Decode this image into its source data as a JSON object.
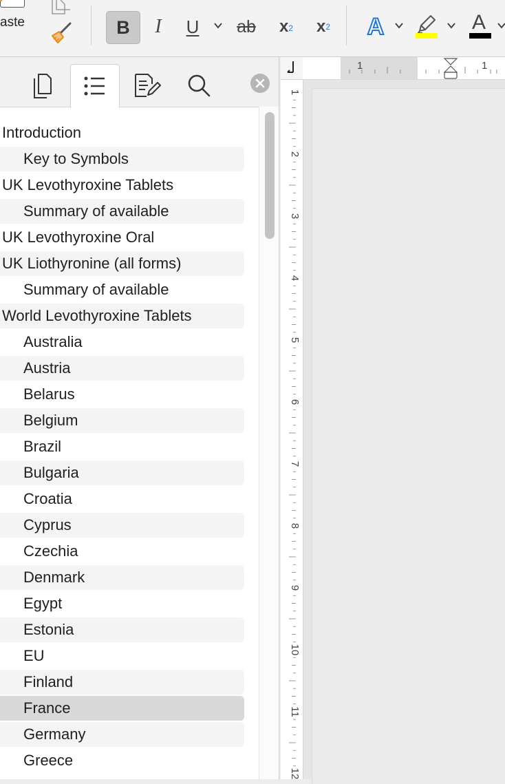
{
  "ribbon": {
    "paste_label": "aste",
    "buttons": {
      "bold": "B",
      "italic": "I",
      "underline": "U",
      "strikethrough": "ab",
      "subscript_base": "x",
      "subscript_mark": "2",
      "superscript_base": "x",
      "superscript_mark": "2",
      "text_effects": "A",
      "font_color": "A"
    },
    "colors": {
      "highlight": "#ffff00",
      "font_color": "#000000",
      "text_effects": "#1f75d9"
    },
    "icons": [
      "copy-icon",
      "format-painter-icon",
      "chevron-down-icon",
      "highlighter-icon"
    ]
  },
  "sidebar": {
    "tabs": [
      {
        "name": "thumbnails",
        "icon": "pages-icon",
        "active": false
      },
      {
        "name": "navigation",
        "icon": "list-icon",
        "active": true
      },
      {
        "name": "comments",
        "icon": "edit-document-icon",
        "active": false
      },
      {
        "name": "search",
        "icon": "search-icon",
        "active": false
      }
    ],
    "close_icon": "close-icon",
    "items": [
      {
        "label": "Introduction",
        "level": 1
      },
      {
        "label": "Key to Symbols",
        "level": 2
      },
      {
        "label": "UK Levothyroxine Tablets",
        "level": 1
      },
      {
        "label": "Summary of available",
        "level": 2
      },
      {
        "label": "UK Levothyroxine Oral",
        "level": 1
      },
      {
        "label": "UK Liothyronine (all forms)",
        "level": 1
      },
      {
        "label": "Summary of available",
        "level": 2
      },
      {
        "label": "World Levothyroxine Tablets",
        "level": 1
      },
      {
        "label": "Australia",
        "level": 2
      },
      {
        "label": "Austria",
        "level": 2
      },
      {
        "label": "Belarus",
        "level": 2
      },
      {
        "label": "Belgium",
        "level": 2
      },
      {
        "label": "Brazil",
        "level": 2
      },
      {
        "label": "Bulgaria",
        "level": 2
      },
      {
        "label": "Croatia",
        "level": 2
      },
      {
        "label": "Cyprus",
        "level": 2
      },
      {
        "label": "Czechia",
        "level": 2
      },
      {
        "label": "Denmark",
        "level": 2
      },
      {
        "label": "Egypt",
        "level": 2
      },
      {
        "label": "Estonia",
        "level": 2
      },
      {
        "label": "EU",
        "level": 2
      },
      {
        "label": "Finland",
        "level": 2
      },
      {
        "label": "France",
        "level": 2,
        "selected": true
      },
      {
        "label": "Germany",
        "level": 2
      },
      {
        "label": "Greece",
        "level": 2
      }
    ]
  },
  "rulers": {
    "horizontal_labels": [
      "1",
      "1"
    ],
    "vertical_labels": [
      "1",
      "2",
      "3",
      "4",
      "5",
      "6",
      "7",
      "8",
      "9",
      "10",
      "11",
      "12"
    ]
  }
}
